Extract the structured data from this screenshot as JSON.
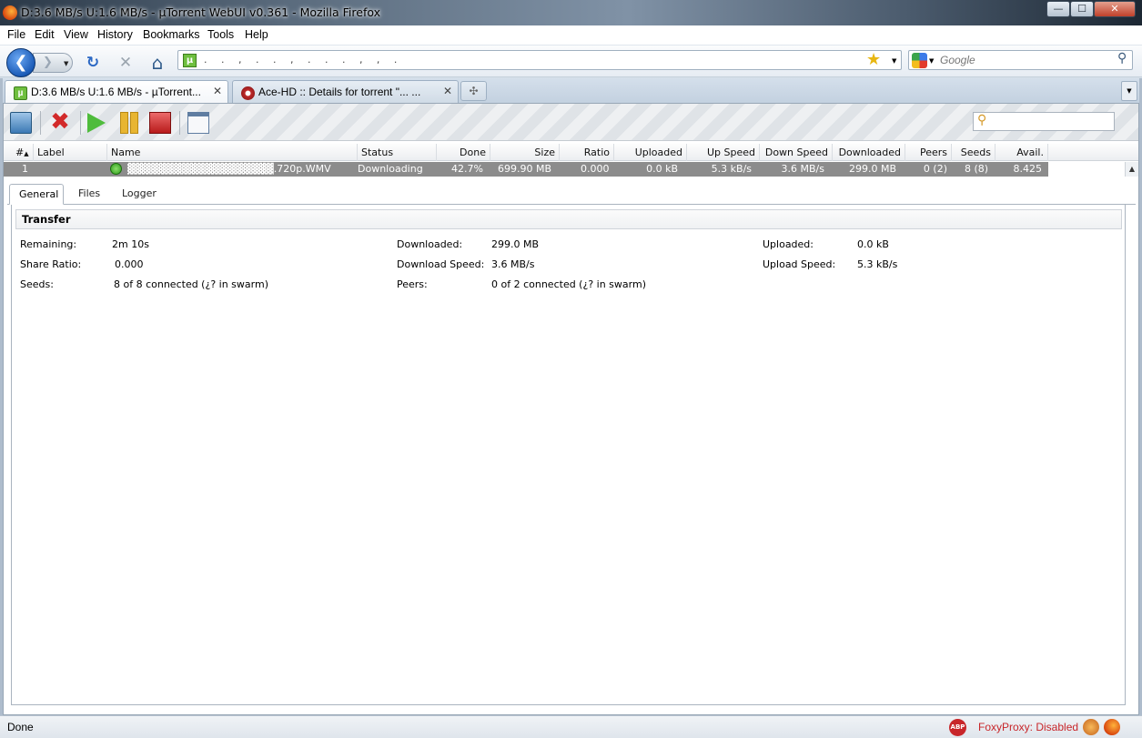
{
  "window": {
    "title": "D:3.6 MB/s U:1.6 MB/s - µTorrent WebUI v0.361 - Mozilla Firefox",
    "min_glyph": "—",
    "max_glyph": "☐",
    "close_glyph": "✕"
  },
  "menu": [
    "File",
    "Edit",
    "View",
    "History",
    "Bookmarks",
    "Tools",
    "Help"
  ],
  "nav": {
    "back_glyph": "❮",
    "forward_glyph": "❯",
    "reload_glyph": "↻",
    "stop_glyph": "✕",
    "home_glyph": "⌂",
    "url_text": ". . , . . , . . . , , .",
    "url_site_glyph": "µ",
    "bookmark_star": "★",
    "search_placeholder": "Google",
    "search_glyph": "⚲"
  },
  "tabs": [
    {
      "label": "D:3.6 MB/s U:1.6 MB/s - µTorrent...",
      "close": "✕",
      "active": true
    },
    {
      "label": "Ace-HD :: Details for torrent \"...  ...",
      "close": "✕",
      "active": false
    }
  ],
  "newtab_glyph": "✣",
  "tablist_glyph": "▼",
  "utorrent": {
    "toolbar": {
      "remove_glyph": "✖",
      "filter_glyph": "⚲"
    },
    "columns": [
      "#",
      "Label",
      "Name",
      "Status",
      "Done",
      "Size",
      "Ratio",
      "Uploaded",
      "Up Speed",
      "Down Speed",
      "Downloaded",
      "Peers",
      "Seeds",
      "Avail."
    ],
    "sort_indicator": "▲",
    "rows": [
      {
        "num": "1",
        "label": "",
        "name": "▓▓▓▓▓▓▓▓▓▓▓▓▓▓▓▓▓▓▓.720p.WMV",
        "status": "Downloading",
        "done": "42.7%",
        "size": "699.90 MB",
        "ratio": "0.000",
        "uploaded": "0.0 kB",
        "up_speed": "5.3 kB/s",
        "down_speed": "3.6 MB/s",
        "downloaded": "299.0 MB",
        "peers": "0 (2)",
        "seeds": "8 (8)",
        "avail": "8.425"
      }
    ],
    "scroll_up_glyph": "▲",
    "detail_tabs": [
      "General",
      "Files",
      "Logger"
    ],
    "transfer": {
      "heading": "Transfer",
      "remaining_label": "Remaining:",
      "remaining_value": "2m 10s",
      "share_ratio_label": "Share Ratio:",
      "share_ratio_value": "0.000",
      "seeds_label": "Seeds:",
      "seeds_value": "8 of 8 connected (¿? in swarm)",
      "downloaded_label": "Downloaded:",
      "downloaded_value": "299.0 MB",
      "download_speed_label": "Download Speed:",
      "download_speed_value": "3.6 MB/s",
      "peers_label": "Peers:",
      "peers_value": "0 of 2 connected (¿? in swarm)",
      "uploaded_label": "Uploaded:",
      "uploaded_value": "0.0 kB",
      "upload_speed_label": "Upload Speed:",
      "upload_speed_value": "5.3 kB/s"
    }
  },
  "statusbar": {
    "text": "Done",
    "abp": "ABP",
    "foxyproxy": "FoxyProxy: Disabled"
  },
  "colors": {
    "selected_row": "#8c8c8c",
    "foxyproxy_text": "#c8262a"
  }
}
